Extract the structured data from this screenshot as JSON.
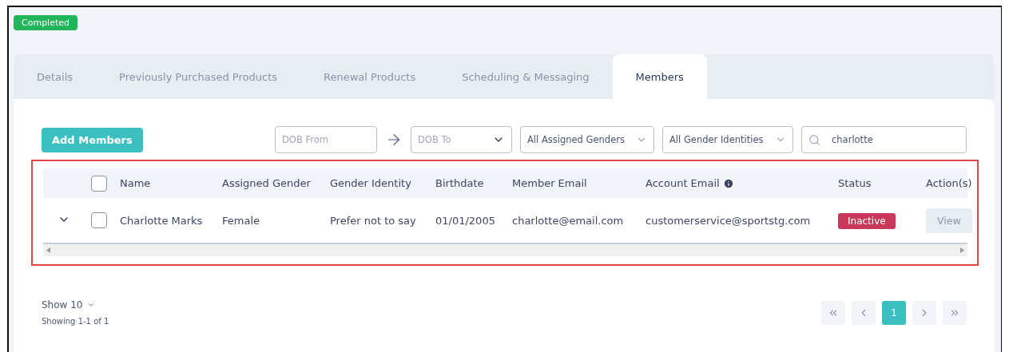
{
  "status_badge": "Completed",
  "tabs": [
    {
      "label": "Details",
      "selected": false
    },
    {
      "label": "Previously Purchased Products",
      "selected": false
    },
    {
      "label": "Renewal Products",
      "selected": false
    },
    {
      "label": "Scheduling & Messaging",
      "selected": false
    },
    {
      "label": "Members",
      "selected": true
    }
  ],
  "toolbar": {
    "add_button": "Add Members",
    "dob_from": {
      "placeholder": "DOB From"
    },
    "dob_to": {
      "placeholder": "DOB To"
    },
    "assigned_gender": "All Assigned Genders",
    "gender_identity": "All Gender Identities",
    "search": {
      "value": "charlotte"
    }
  },
  "table": {
    "all_checked": false,
    "columns": [
      {
        "label": "Name",
        "info": false
      },
      {
        "label": "Assigned Gender",
        "info": false
      },
      {
        "label": "Gender Identity",
        "info": false
      },
      {
        "label": "Birthdate",
        "info": false
      },
      {
        "label": "Member Email",
        "info": false
      },
      {
        "label": "Account Email",
        "info": true
      },
      {
        "label": "Status",
        "info": false
      },
      {
        "label": "Action(s)",
        "info": false
      }
    ],
    "rows": [
      {
        "expanded": false,
        "checked": false,
        "cells": [
          "Charlotte Marks",
          "Female",
          "Prefer not to say",
          "01/01/2005",
          "charlotte@email.com",
          "customerservice@sportstg.com"
        ],
        "status": {
          "label": "Inactive",
          "color": "#c8385a"
        },
        "action": "View"
      }
    ]
  },
  "footer": {
    "page_size": "Show 10",
    "summary": "Showing 1-1 of 1",
    "pages": [
      {
        "label": "1",
        "selected": true
      }
    ]
  }
}
